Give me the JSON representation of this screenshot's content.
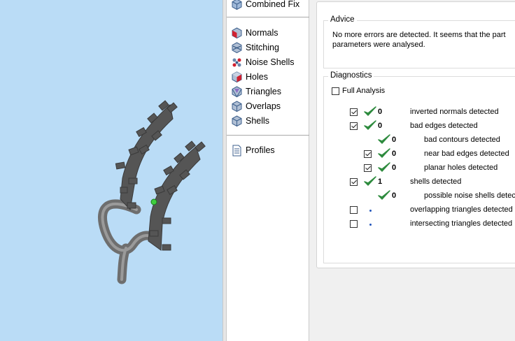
{
  "viewport": {
    "background": "#badcf6",
    "model_color": "#5a5a5a"
  },
  "sidebar": {
    "top_item": {
      "label": "Combined Fix",
      "icon": "cube-icon"
    },
    "items": [
      {
        "label": "Normals",
        "icon": "normals-icon"
      },
      {
        "label": "Stitching",
        "icon": "stitching-icon"
      },
      {
        "label": "Noise Shells",
        "icon": "noise-shells-icon"
      },
      {
        "label": "Holes",
        "icon": "holes-icon"
      },
      {
        "label": "Triangles",
        "icon": "triangles-icon"
      },
      {
        "label": "Overlaps",
        "icon": "overlaps-icon"
      },
      {
        "label": "Shells",
        "icon": "shells-icon"
      }
    ],
    "profiles": {
      "label": "Profiles",
      "icon": "document-icon"
    }
  },
  "advice": {
    "title": "Advice",
    "line1": "No more errors are detected. It seems that the part",
    "line2": "parameters were analysed."
  },
  "diagnostics": {
    "title": "Diagnostics",
    "full_analysis": {
      "label": "Full Analysis",
      "checked": false
    },
    "rows": [
      {
        "checkbox": true,
        "checked": true,
        "status": "ok",
        "count": "0",
        "label": "inverted normals detected"
      },
      {
        "checkbox": true,
        "checked": true,
        "status": "ok",
        "count": "0",
        "label": "bad edges detected"
      },
      {
        "checkbox": false,
        "checked": false,
        "status": "ok",
        "count": "0",
        "label": "bad contours detected"
      },
      {
        "checkbox": true,
        "checked": true,
        "status": "ok",
        "count": "0",
        "label": "near bad edges detected"
      },
      {
        "checkbox": true,
        "checked": true,
        "status": "ok",
        "count": "0",
        "label": "planar holes detected"
      },
      {
        "checkbox": true,
        "checked": true,
        "status": "ok",
        "count": "1",
        "label": "shells detected"
      },
      {
        "checkbox": false,
        "checked": false,
        "status": "ok",
        "count": "0",
        "label": "possible noise shells detec"
      },
      {
        "checkbox": true,
        "checked": false,
        "status": "pending",
        "count": "",
        "label": "overlapping triangles detected"
      },
      {
        "checkbox": true,
        "checked": false,
        "status": "pending",
        "count": "",
        "label": "intersecting triangles detected"
      }
    ]
  },
  "colors": {
    "check_green": "#2e8b3e",
    "pending_dot": "#2255bb"
  }
}
